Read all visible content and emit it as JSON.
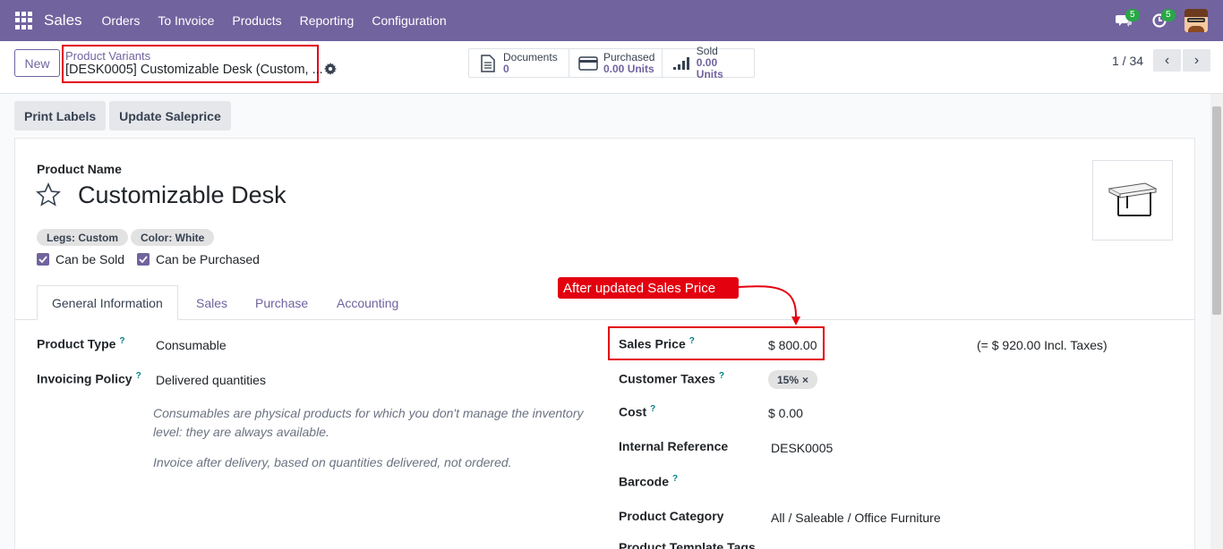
{
  "navbar": {
    "brand": "Sales",
    "menu": [
      "Orders",
      "To Invoice",
      "Products",
      "Reporting",
      "Configuration"
    ],
    "chat_badge": "5",
    "activity_badge": "5",
    "color": "#71639e"
  },
  "control": {
    "new_label": "New",
    "breadcrumb_parent": "Product Variants",
    "breadcrumb_current": "[DESK0005] Customizable Desk (Custom, ...",
    "stats": [
      {
        "label": "Documents",
        "value": "0",
        "icon": "document-icon"
      },
      {
        "label": "Purchased",
        "value": "0.00 Units",
        "icon": "credit-card-icon"
      },
      {
        "label": "Sold",
        "value": "0.00 Units",
        "icon": "signal-bars-icon"
      }
    ],
    "pager": "1 / 34"
  },
  "actions": {
    "print_labels": "Print Labels",
    "update_saleprice": "Update Saleprice"
  },
  "product": {
    "name_label": "Product Name",
    "name": "Customizable Desk",
    "tags": [
      "Legs: Custom",
      "Color: White"
    ],
    "can_be_sold": "Can be Sold",
    "can_be_purchased": "Can be Purchased"
  },
  "tabs": [
    "General Information",
    "Sales",
    "Purchase",
    "Accounting"
  ],
  "annotation": "After updated Sales Price",
  "left_fields": {
    "product_type_label": "Product Type",
    "product_type": "Consumable",
    "invoicing_policy_label": "Invoicing Policy",
    "invoicing_policy": "Delivered quantities",
    "help1": "Consumables are physical products for which you don't manage the inventory level: they are always available.",
    "help2": "Invoice after delivery, based on quantities delivered, not ordered."
  },
  "right_fields": {
    "sales_price_label": "Sales Price",
    "sales_price": "$ 800.00",
    "incl_taxes": "(= $ 920.00 Incl. Taxes)",
    "customer_taxes_label": "Customer Taxes",
    "customer_tax": "15%",
    "cost_label": "Cost",
    "cost": "$ 0.00",
    "internal_ref_label": "Internal Reference",
    "internal_ref": "DESK0005",
    "barcode_label": "Barcode",
    "category_label": "Product Category",
    "category": "All / Saleable / Office Furniture",
    "template_tags_label": "Product Template Tags"
  }
}
